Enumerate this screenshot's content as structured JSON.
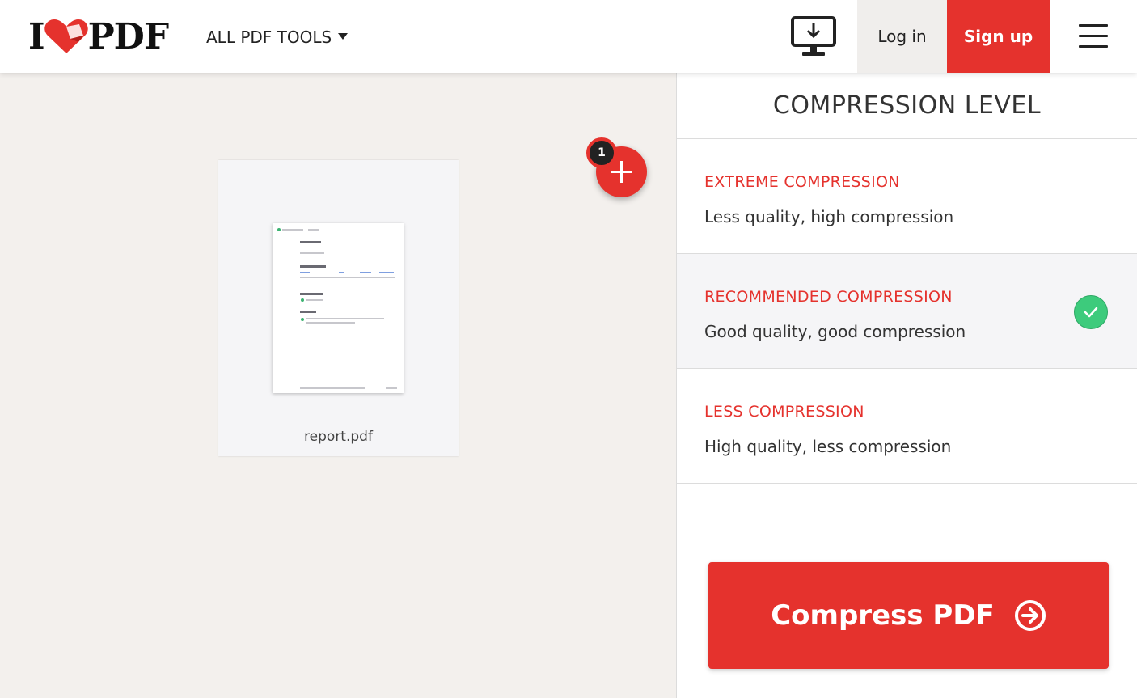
{
  "header": {
    "logo": {
      "left": "I",
      "right": "PDF"
    },
    "tools_menu": "ALL PDF TOOLS",
    "login": "Log in",
    "signup": "Sign up"
  },
  "workspace": {
    "file": {
      "name": "report.pdf"
    },
    "file_count": "1"
  },
  "sidebar": {
    "title": "COMPRESSION LEVEL",
    "options": [
      {
        "title": "EXTREME COMPRESSION",
        "desc": "Less quality, high compression",
        "selected": false
      },
      {
        "title": "RECOMMENDED COMPRESSION",
        "desc": "Good quality, good compression",
        "selected": true
      },
      {
        "title": "LESS COMPRESSION",
        "desc": "High quality, less compression",
        "selected": false
      }
    ],
    "action": "Compress PDF"
  },
  "colors": {
    "brand_red": "#e5322d",
    "check_green": "#3dcb7c"
  },
  "icons": [
    "heart-logo-icon",
    "caret-down-icon",
    "desktop-download-icon",
    "hamburger-icon",
    "plus-icon",
    "check-icon",
    "arrow-right-circle-icon"
  ]
}
